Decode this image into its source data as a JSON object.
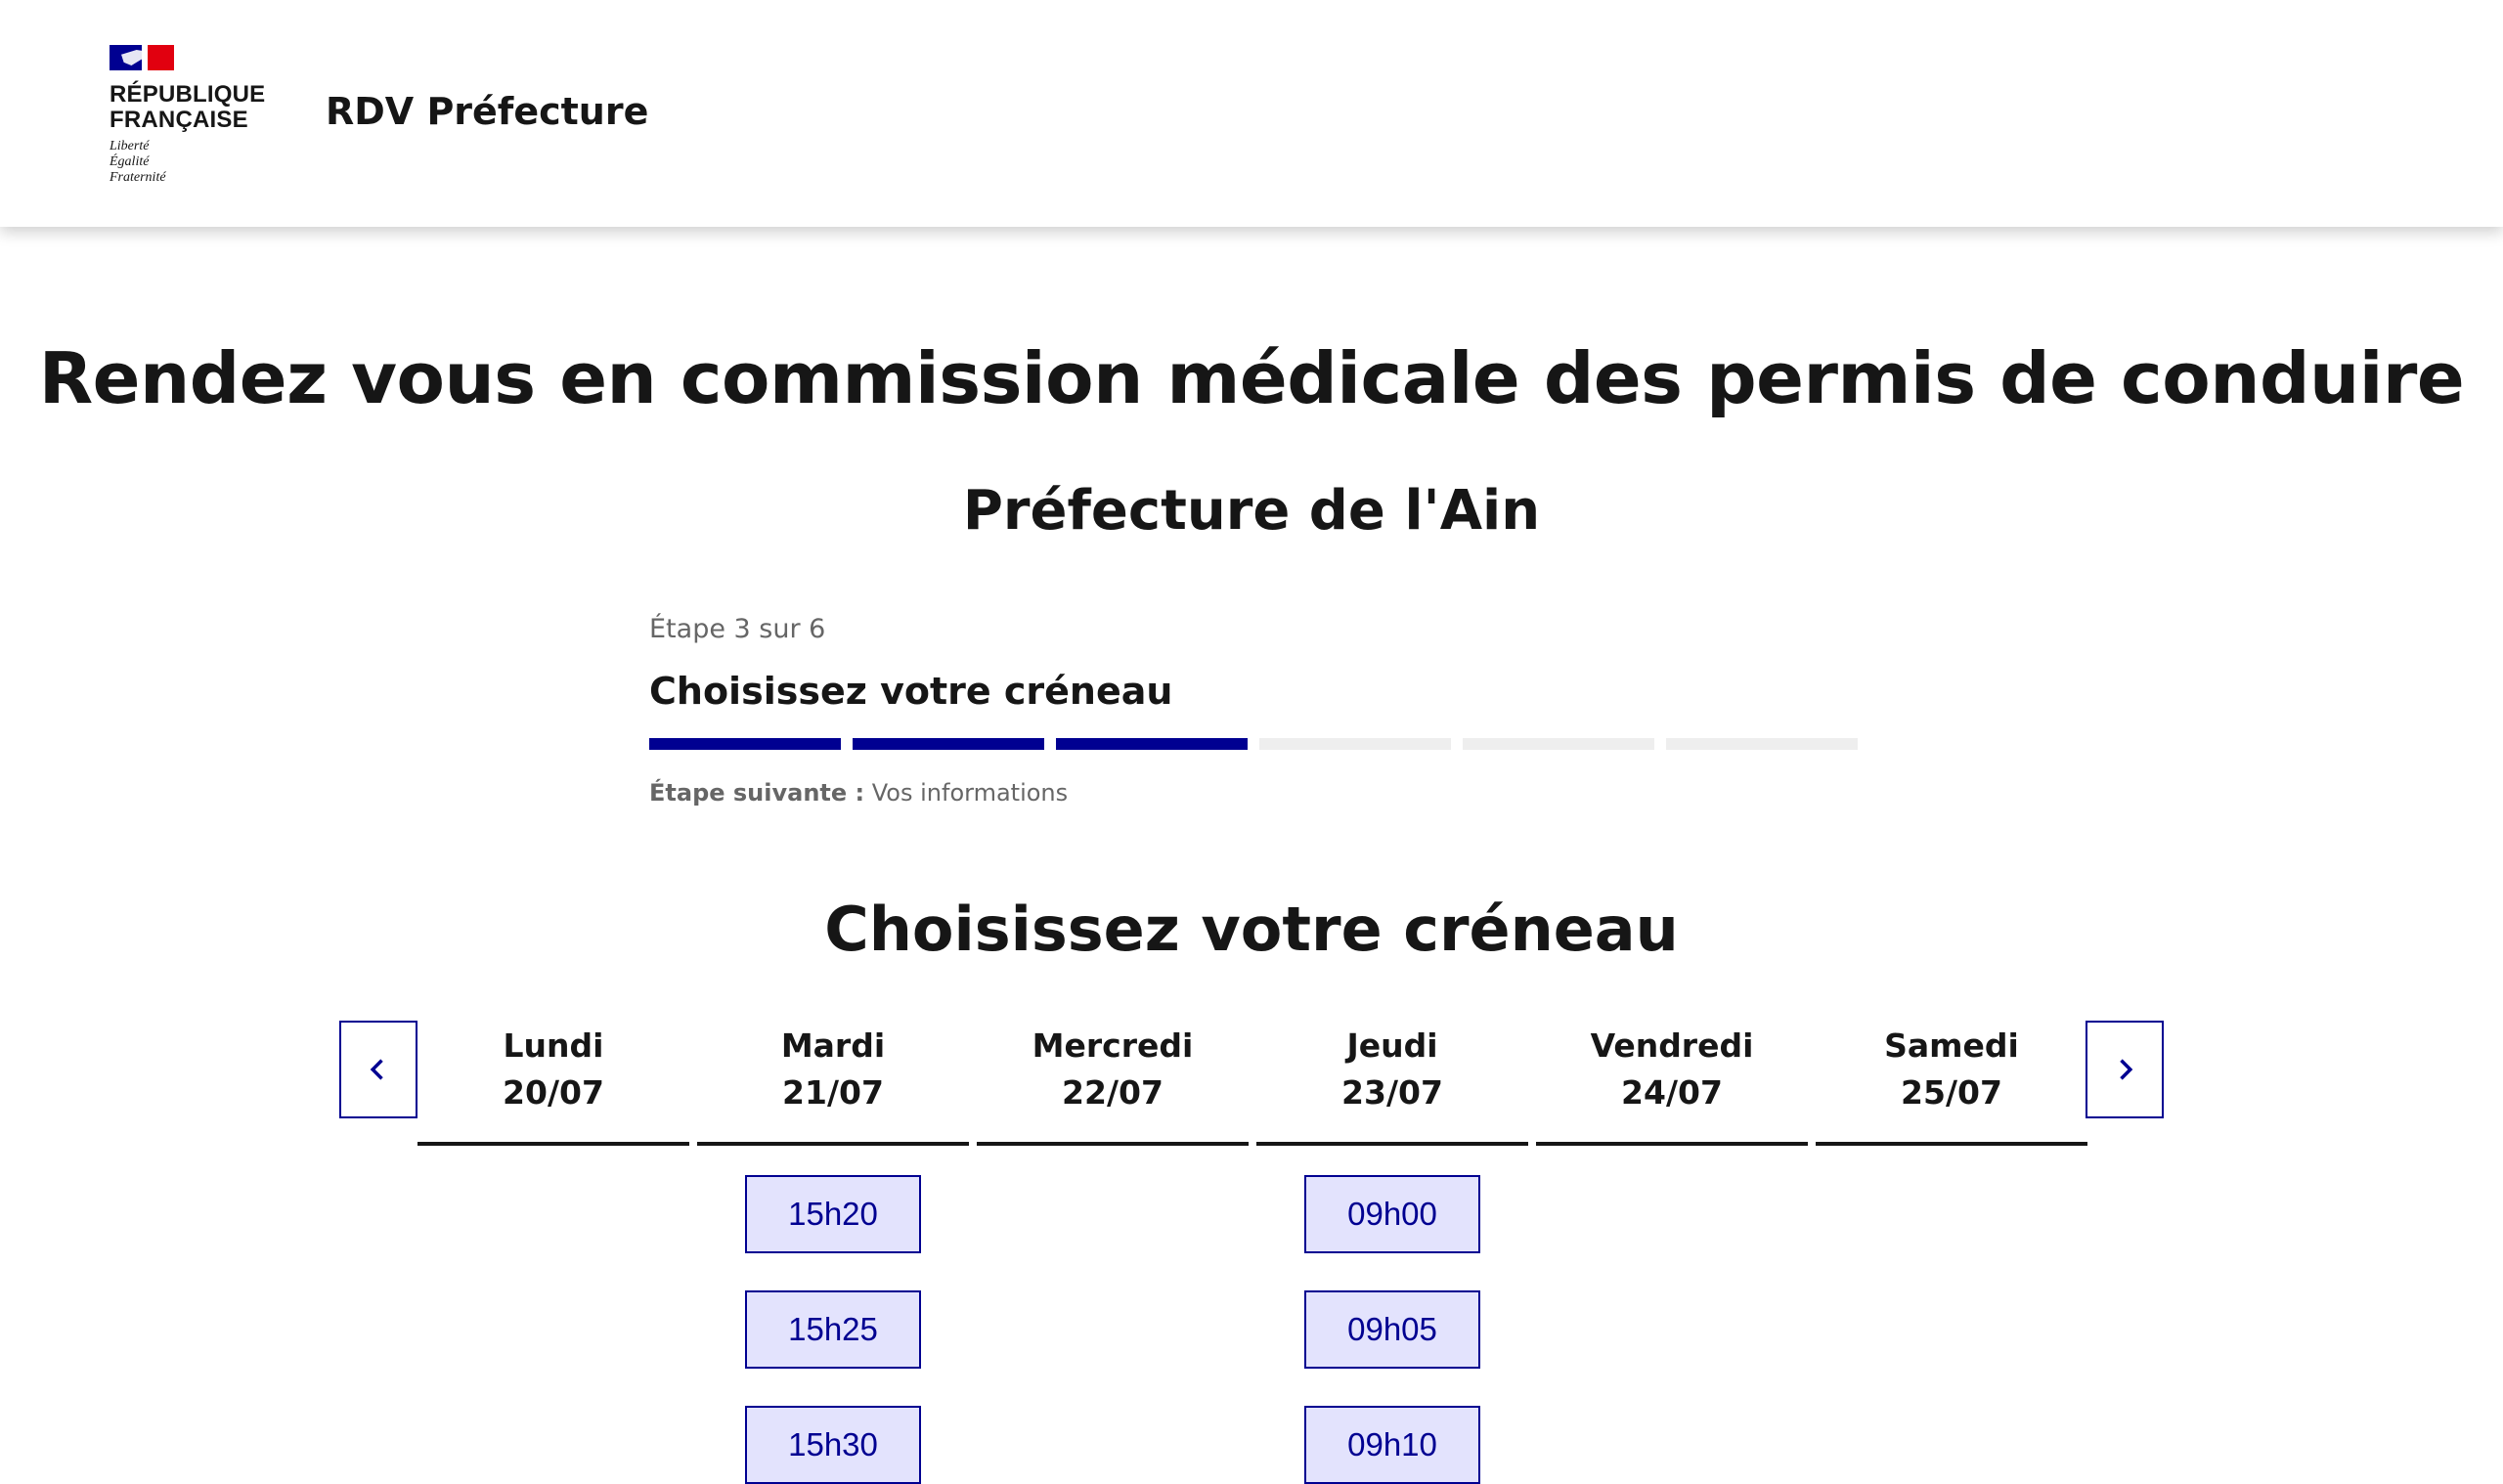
{
  "header": {
    "logo_line1": "RÉPUBLIQUE",
    "logo_line2": "FRANÇAISE",
    "devise1": "Liberté",
    "devise2": "Égalité",
    "devise3": "Fraternité",
    "site_title": "RDV Préfecture"
  },
  "main_title": "Rendez vous en commission médicale des permis de conduire",
  "sub_title": "Préfecture de l'Ain",
  "stepper": {
    "count": "Étape 3 sur 6",
    "current": 3,
    "total": 6,
    "title": "Choisissez votre créneau",
    "next_label": "Étape suivante :",
    "next_value": "Vos informations"
  },
  "calendar": {
    "title": "Choisissez votre créneau",
    "prev_icon": "chevron-left-icon",
    "next_icon": "chevron-right-icon",
    "days": [
      {
        "name": "Lundi",
        "date": "20/07",
        "slots": []
      },
      {
        "name": "Mardi",
        "date": "21/07",
        "slots": [
          "15h20",
          "15h25",
          "15h30"
        ]
      },
      {
        "name": "Mercredi",
        "date": "22/07",
        "slots": []
      },
      {
        "name": "Jeudi",
        "date": "23/07",
        "slots": [
          "09h00",
          "09h05",
          "09h10"
        ]
      },
      {
        "name": "Vendredi",
        "date": "24/07",
        "slots": []
      },
      {
        "name": "Samedi",
        "date": "25/07",
        "slots": []
      }
    ]
  },
  "colors": {
    "primary": "#000091",
    "slot_bg": "#e3e3fd",
    "text": "#161616",
    "muted": "#666666"
  }
}
